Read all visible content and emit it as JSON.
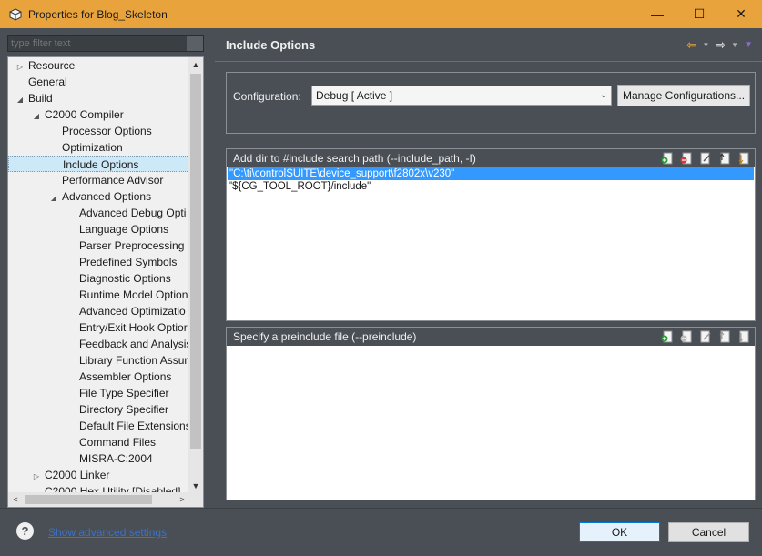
{
  "window": {
    "title": "Properties for Blog_Skeleton",
    "minimize": "—",
    "maximize": "☐",
    "close": "✕"
  },
  "sidebar": {
    "filter_placeholder": "type filter text",
    "items": [
      {
        "label": "Resource",
        "twisty": "▷"
      },
      {
        "label": "General",
        "twisty": ""
      },
      {
        "label": "Build",
        "twisty": "◢"
      },
      {
        "label": "C2000 Compiler",
        "twisty": "◢"
      },
      {
        "label": "Processor Options",
        "twisty": ""
      },
      {
        "label": "Optimization",
        "twisty": ""
      },
      {
        "label": "Include Options",
        "twisty": ""
      },
      {
        "label": "Performance Advisor",
        "twisty": ""
      },
      {
        "label": "Advanced Options",
        "twisty": "◢"
      },
      {
        "label": "Advanced Debug Opti",
        "twisty": ""
      },
      {
        "label": "Language Options",
        "twisty": ""
      },
      {
        "label": "Parser Preprocessing C",
        "twisty": ""
      },
      {
        "label": "Predefined Symbols",
        "twisty": ""
      },
      {
        "label": "Diagnostic Options",
        "twisty": ""
      },
      {
        "label": "Runtime Model Option",
        "twisty": ""
      },
      {
        "label": "Advanced Optimizatio",
        "twisty": ""
      },
      {
        "label": "Entry/Exit Hook Optior",
        "twisty": ""
      },
      {
        "label": "Feedback and Analysis",
        "twisty": ""
      },
      {
        "label": "Library Function Assun",
        "twisty": ""
      },
      {
        "label": "Assembler Options",
        "twisty": ""
      },
      {
        "label": "File Type Specifier",
        "twisty": ""
      },
      {
        "label": "Directory Specifier",
        "twisty": ""
      },
      {
        "label": "Default File Extensions",
        "twisty": ""
      },
      {
        "label": "Command Files",
        "twisty": ""
      },
      {
        "label": "MISRA-C:2004",
        "twisty": ""
      },
      {
        "label": "C2000 Linker",
        "twisty": "▷"
      },
      {
        "label": "C2000 Hex Utility  [Disabled]",
        "twisty": ""
      }
    ],
    "scroll_up": "▲",
    "scroll_down": "▼",
    "scroll_left": "<",
    "scroll_right": ">"
  },
  "main": {
    "title": "Include Options",
    "nav": {
      "back": "⇦",
      "forward": "⇨",
      "dropdown": "▼",
      "menu": "▼"
    },
    "config_label": "Configuration:",
    "config_value": "Debug  [ Active ]",
    "config_chevron": "⌄",
    "manage_button": "Manage Configurations...",
    "include_panel": {
      "title": "Add dir to #include search path (--include_path, -I)",
      "rows": [
        "\"C:\\ti\\controlSUITE\\device_support\\f2802x\\v230\"",
        "\"${CG_TOOL_ROOT}/include\""
      ]
    },
    "preinclude_panel": {
      "title": "Specify a preinclude file (--preinclude)",
      "rows": []
    }
  },
  "footer": {
    "help": "?",
    "advanced_link": "Show advanced settings",
    "ok": "OK",
    "cancel": "Cancel"
  },
  "colors": {
    "titlebar": "#e8a33d",
    "panel_bg": "#4a4f55",
    "selection": "#3399ff"
  }
}
